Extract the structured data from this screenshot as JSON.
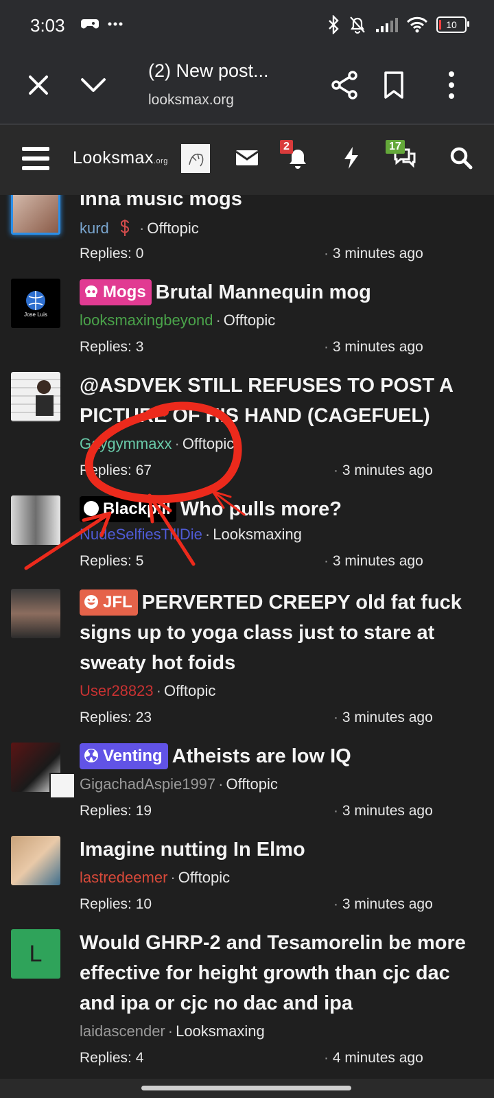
{
  "status": {
    "time": "3:03",
    "battery": "10"
  },
  "browser": {
    "title": "(2) New post...",
    "url": "looksmax.org"
  },
  "nav": {
    "logo_main": "Looksmax",
    "logo_tld": ".org",
    "alerts_count": "2",
    "conversations_count": "17"
  },
  "threads": [
    {
      "label": "",
      "title": "Inna music mogs",
      "author": "kurd",
      "forum": "Offtopic",
      "replies": "Replies: 0",
      "time": "3 minutes ago",
      "author_color": "#7aa6cf"
    },
    {
      "label": "Mogs",
      "title": "Brutal Mannequin mog",
      "author": "looksmaxingbeyond",
      "forum": "Offtopic",
      "replies": "Replies: 3",
      "time": "3 minutes ago",
      "author_color": "#4aa34a",
      "avatar_text": "Jose Luis"
    },
    {
      "label": "",
      "title": "@ASDVEK STILL REFUSES TO POST A PICTURE OF HIS HAND (CAGEFUEL)",
      "author": "Gaygymmaxx",
      "forum": "Offtopic",
      "replies": "Replies: 67",
      "time": "3 minutes ago",
      "author_color": "#69c9a8"
    },
    {
      "label": "Blackpill",
      "title": "Who pulls more?",
      "author": "NudeSelfiesTillDie",
      "forum": "Looksmaxing",
      "replies": "Replies: 5",
      "time": "3 minutes ago",
      "author_color": "#4f5bd6"
    },
    {
      "label": "JFL",
      "title": "PERVERTED CREEPY old fat fuck signs up to yoga class just to stare at sweaty hot foids",
      "author": "User28823",
      "forum": "Offtopic",
      "replies": "Replies: 23",
      "time": "3 minutes ago",
      "author_color": "#c83232"
    },
    {
      "label": "Venting",
      "title": "Atheists are low IQ",
      "author": "GigachadAspie1997",
      "forum": "Offtopic",
      "replies": "Replies: 19",
      "time": "3 minutes ago",
      "author_color": "#9a9a9a"
    },
    {
      "label": "",
      "title": "Imagine nutting In Elmo",
      "author": "lastredeemer",
      "forum": "Offtopic",
      "replies": "Replies: 10",
      "time": "3 minutes ago",
      "author_color": "#d94a3a"
    },
    {
      "label": "",
      "title": "Would GHRP-2 and Tesamorelin be more effective for height growth than cjc dac and ipa or cjc no dac and ipa",
      "author": "laidascender",
      "forum": "Looksmaxing",
      "replies": "Replies: 4",
      "time": "4 minutes ago",
      "author_color": "#9a9a9a",
      "avatar_letter": "L"
    }
  ]
}
